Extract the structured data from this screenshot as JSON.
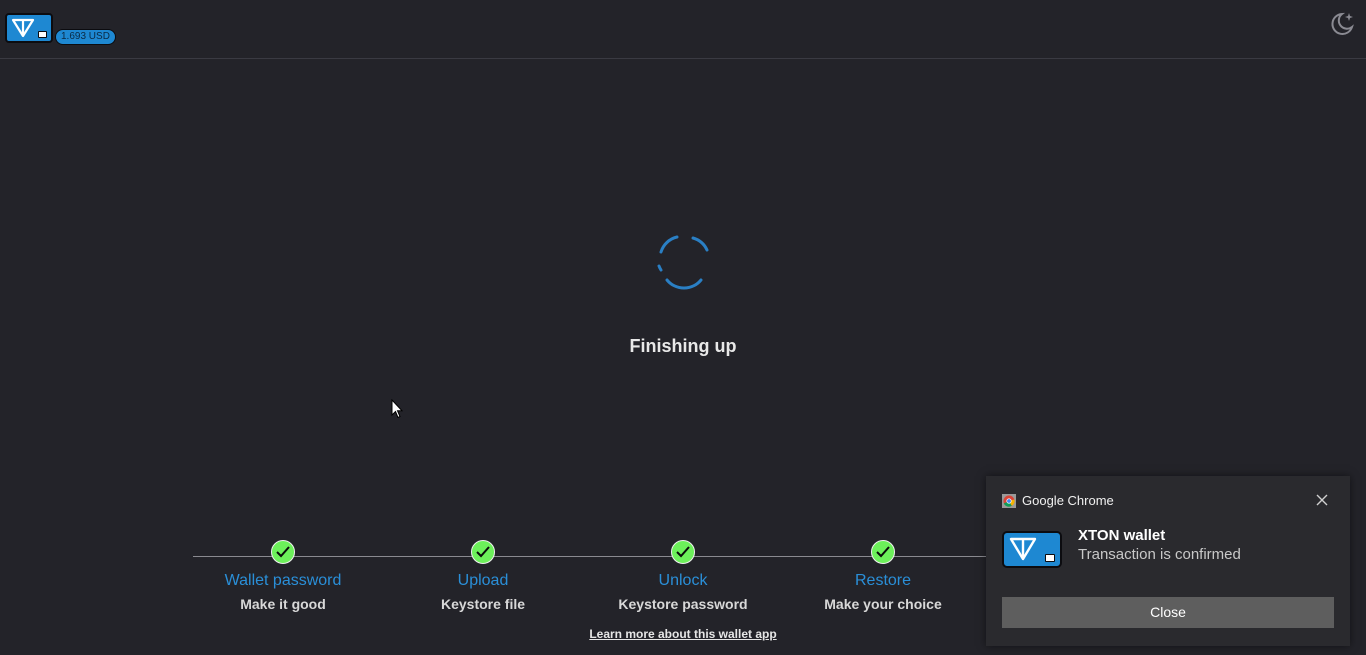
{
  "header": {
    "price_badge": "1.693 USD",
    "logo_icon": "ton-wallet-logo-icon",
    "theme_icon": "moon-star-icon"
  },
  "main": {
    "status_text": "Finishing up",
    "spinner_color": "#2a7fc4"
  },
  "steps": [
    {
      "title": "Wallet password",
      "subtitle": "Make it good",
      "done": true
    },
    {
      "title": "Upload",
      "subtitle": "Keystore file",
      "done": true
    },
    {
      "title": "Unlock",
      "subtitle": "Keystore password",
      "done": true
    },
    {
      "title": "Restore",
      "subtitle": "Make your choice",
      "done": true
    }
  ],
  "footer": {
    "learn_more": "Learn more about this wallet app"
  },
  "notification": {
    "app_name": "Google Chrome",
    "title": "XTON wallet",
    "body": "Transaction is confirmed",
    "close_button": "Close"
  },
  "colors": {
    "background": "#232329",
    "accent": "#1e88d2",
    "step_title": "#2a8fd8",
    "check": "#6cf05a"
  }
}
